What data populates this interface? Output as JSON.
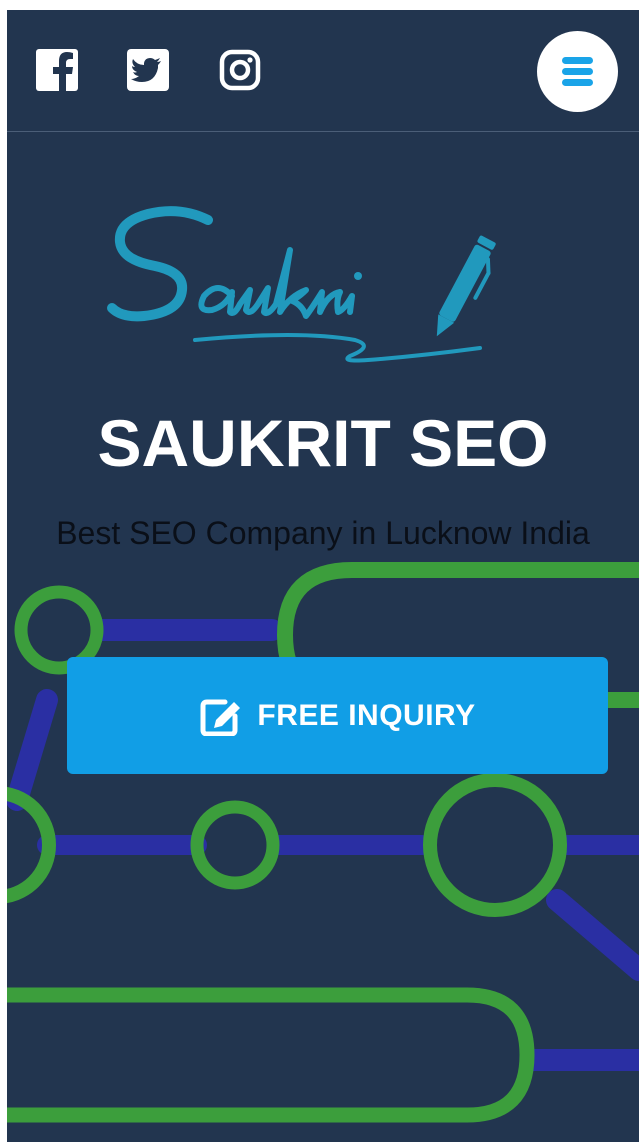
{
  "header": {
    "social": [
      {
        "name": "facebook",
        "icon": "facebook-icon"
      },
      {
        "name": "twitter",
        "icon": "twitter-icon"
      },
      {
        "name": "instagram",
        "icon": "instagram-icon"
      }
    ],
    "menu_icon": "hamburger-menu-icon"
  },
  "hero": {
    "logo_text": "Saukrit",
    "title": "SAUKRIT SEO",
    "subtitle": "Best SEO Company in Lucknow India",
    "cta_label": "FREE INQUIRY",
    "cta_icon": "edit-icon"
  },
  "colors": {
    "background": "#22354f",
    "accent": "#119ee6",
    "logo": "#2199bd",
    "menu_icon": "#1aa4e8",
    "circuit_green": "#3c9e3c",
    "circuit_blue": "#2a2fa3",
    "subtitle_text": "#0a0f18"
  }
}
